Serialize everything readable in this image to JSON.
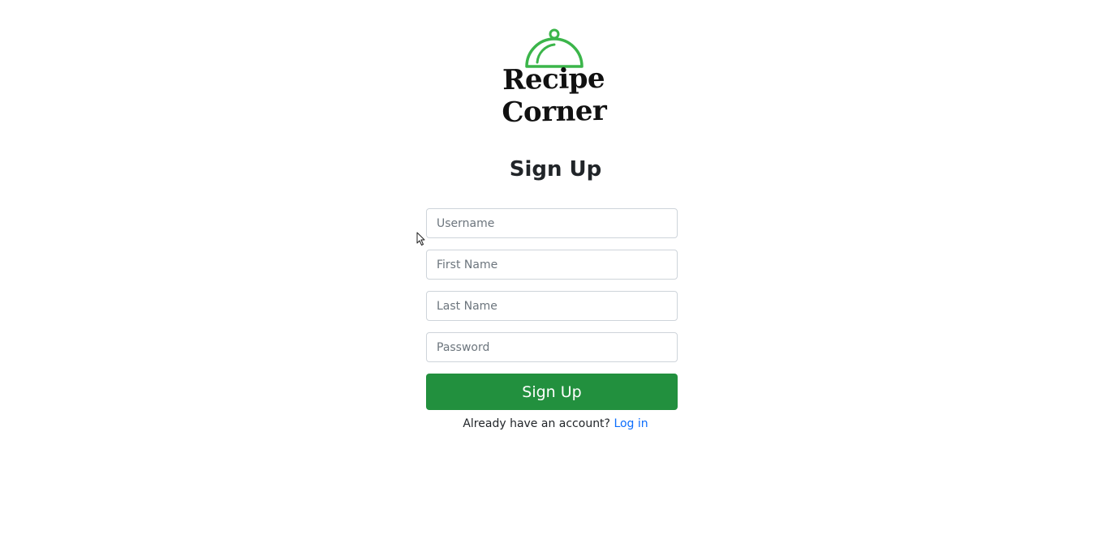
{
  "brand": {
    "name": "Recipe Corner",
    "icon": "cloche-icon",
    "accent_color": "#3bb54a"
  },
  "form": {
    "title": "Sign Up",
    "fields": {
      "username_placeholder": "Username",
      "first_name_placeholder": "First Name",
      "last_name_placeholder": "Last Name",
      "password_placeholder": "Password"
    },
    "submit_label": "Sign Up",
    "submit_color": "#22903e"
  },
  "footer": {
    "prompt": "Already have an account?",
    "login_link": "Log in",
    "link_color": "#0d6efd"
  }
}
